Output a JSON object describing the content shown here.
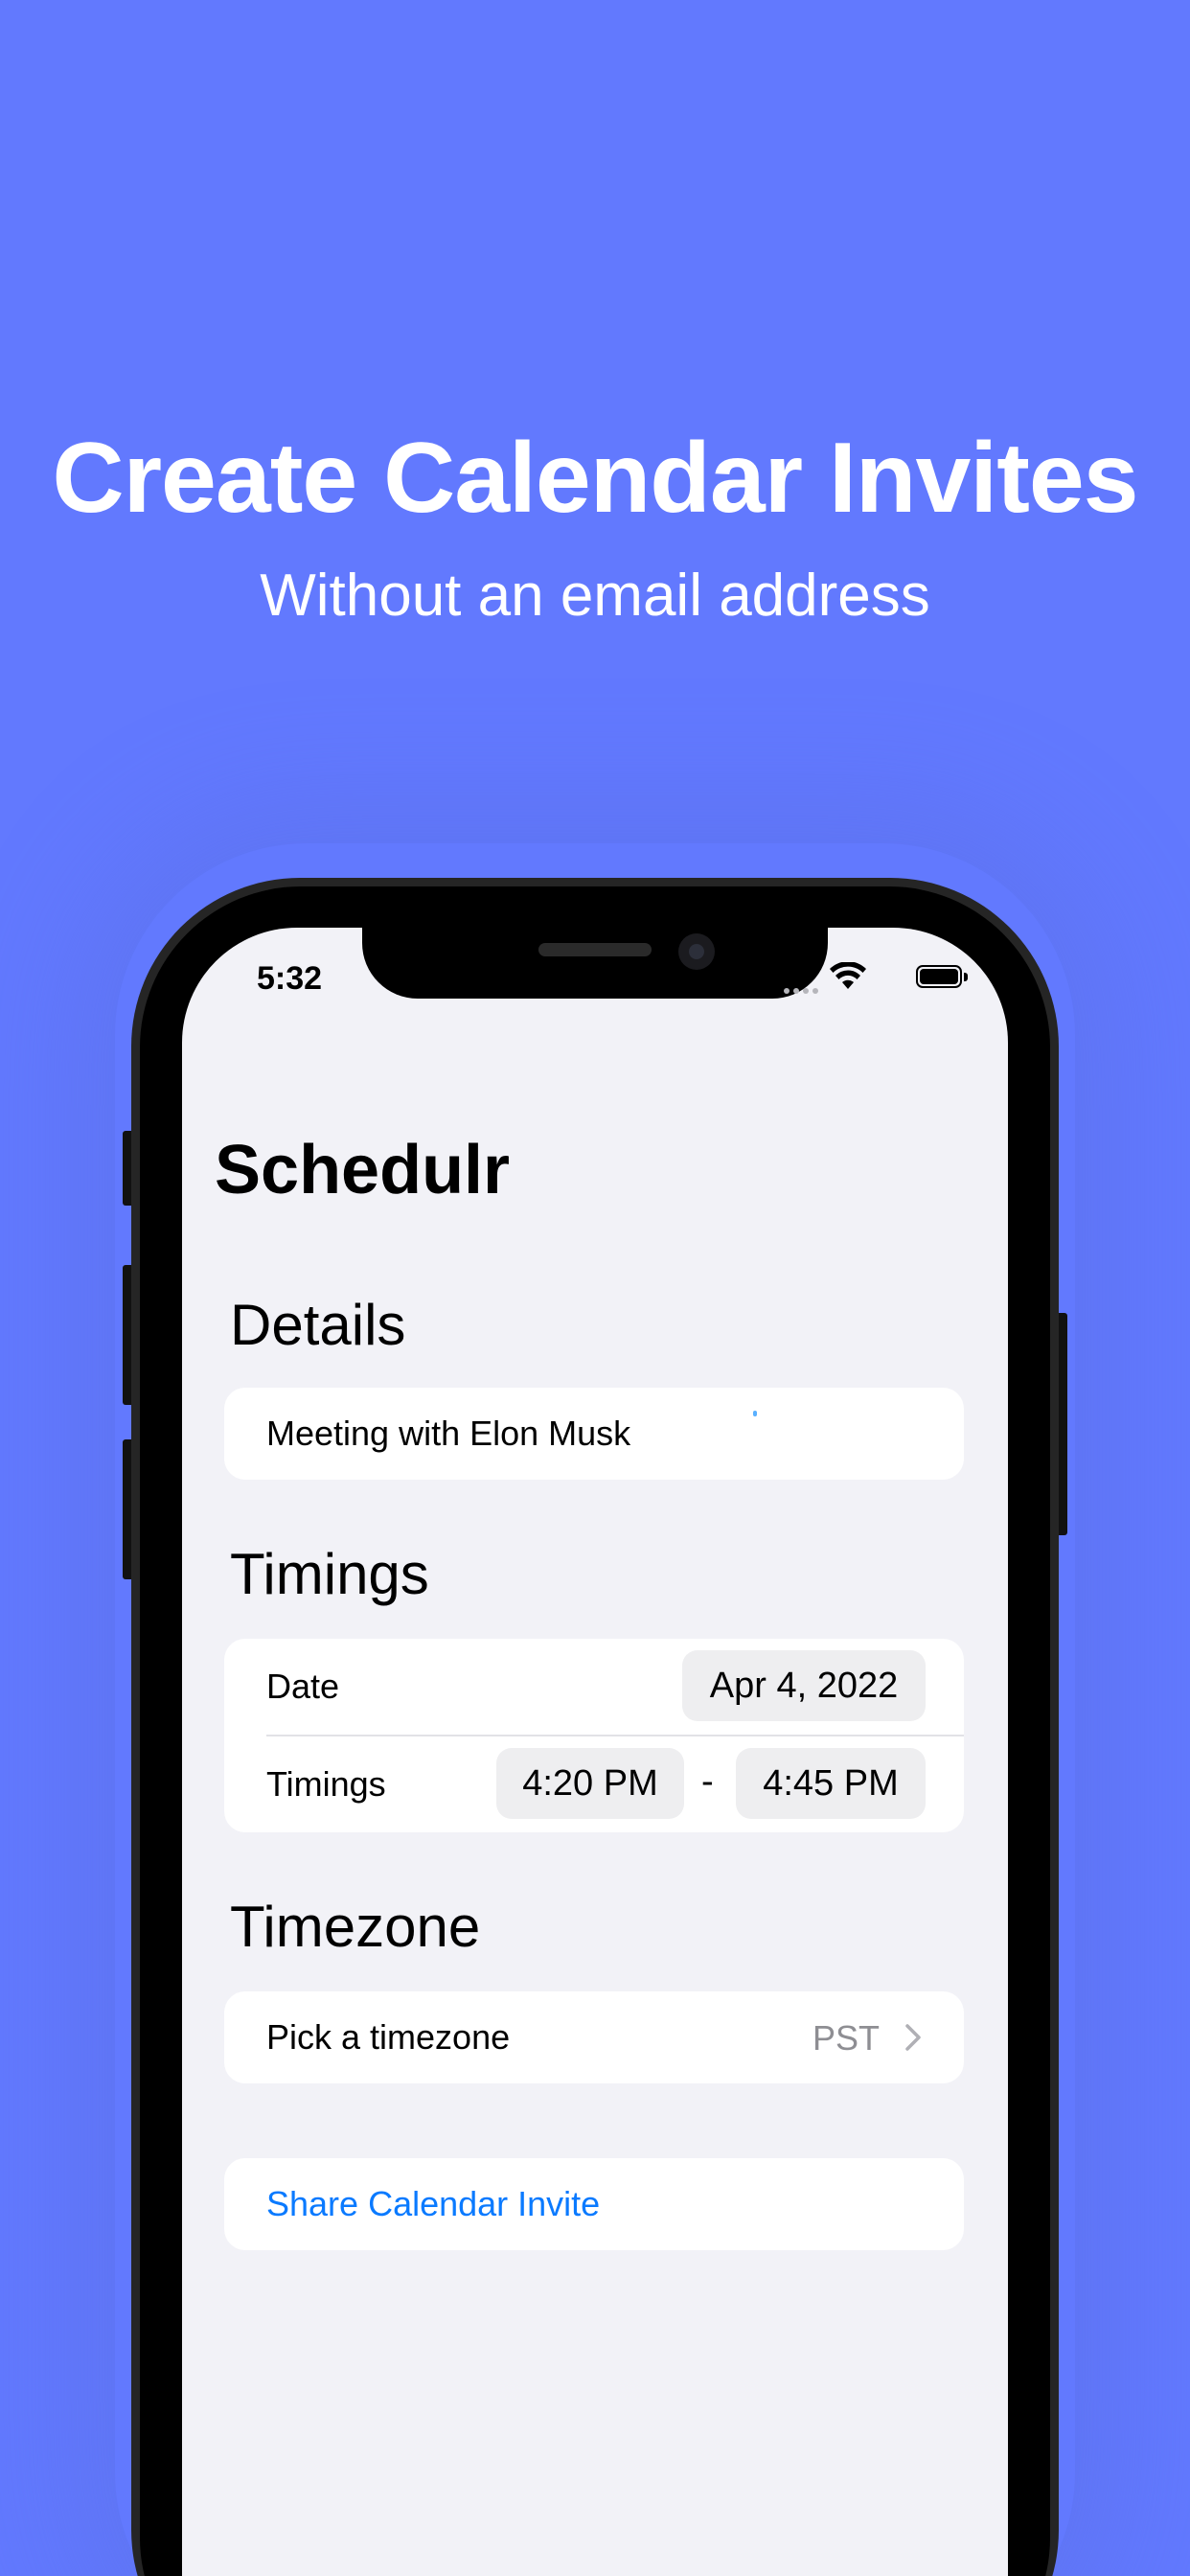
{
  "promo": {
    "headline": "Create Calendar Invites",
    "subheadline": "Without an email address"
  },
  "status_bar": {
    "time": "5:32",
    "icons": [
      "signal-dots-icon",
      "wifi-icon",
      "battery-icon"
    ]
  },
  "app": {
    "title": "Schedulr",
    "details": {
      "section_title": "Details",
      "event_title_value": "Meeting with Elon Musk"
    },
    "timings": {
      "section_title": "Timings",
      "date_label": "Date",
      "date_value": "Apr 4, 2022",
      "time_label": "Timings",
      "start_time": "4:20 PM",
      "separator": "-",
      "end_time": "4:45 PM"
    },
    "timezone": {
      "section_title": "Timezone",
      "picker_label": "Pick a timezone",
      "picker_value": "PST",
      "chevron_icon": "chevron-right-icon"
    },
    "share": {
      "button_label": "Share Calendar Invite"
    }
  },
  "colors": {
    "background": "#6279fe",
    "screen_background": "#f2f2f7",
    "accent_link": "#0a7aff",
    "secondary_text": "#8e8e93"
  }
}
